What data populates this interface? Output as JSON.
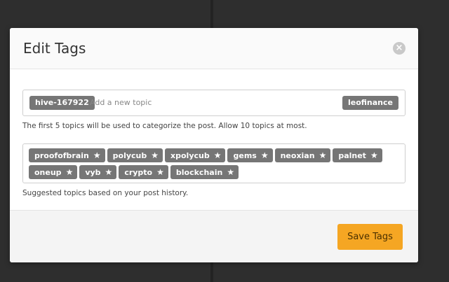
{
  "modal": {
    "title": "Edit Tags",
    "close_icon": "×"
  },
  "tag_input": {
    "left_tag": "hive-167922",
    "placeholder": "Add a new topic",
    "right_tag": "leofinance"
  },
  "hint": "The first 5 topics will be used to categorize the post. Allow 10 topics at most.",
  "suggested": {
    "topics": [
      "proofofbrain",
      "polycub",
      "xpolycub",
      "gems",
      "neoxian",
      "palnet",
      "oneup",
      "vyb",
      "crypto",
      "blockchain"
    ],
    "star_icon": "★"
  },
  "suggested_hint": "Suggested topics based on your post history.",
  "footer": {
    "save_label": "Save Tags"
  },
  "colors": {
    "accent": "#f5a623",
    "chip": "#767676"
  }
}
